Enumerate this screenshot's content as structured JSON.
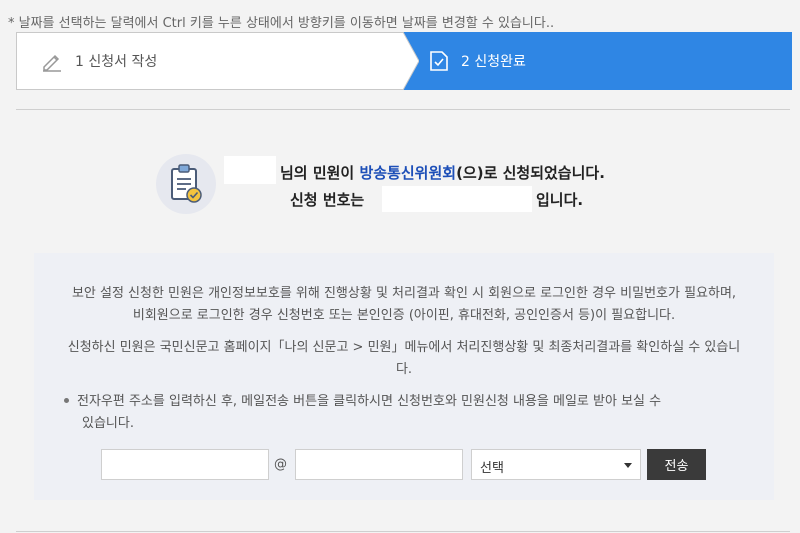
{
  "hint": "* 날짜를 선택하는 달력에서 Ctrl 키를 누른 상태에서 방향키를 이동하면 날짜를 변경할 수 있습니다..",
  "steps": [
    {
      "label": "1 신청서 작성",
      "active": false,
      "icon": "pencil-icon"
    },
    {
      "label": "2 신청완료",
      "active": true,
      "icon": "document-check-icon"
    }
  ],
  "result": {
    "line1_prefix": "님의 민원이 ",
    "organization": "방송통신위원회",
    "line1_suffix": "(으)로 신청되었습니다.",
    "line2_prefix": "신청 번호는",
    "line2_suffix": "입니다."
  },
  "info": {
    "para1": "보안 설정 신청한 민원은 개인정보보호를 위해 진행상황 및 처리결과 확인 시 회원으로 로그인한 경우 비밀번호가 필요하며, 비회원으로 로그인한 경우 신청번호 또는 본인인증 (아이핀, 휴대전화, 공인인증서 등)이 필요합니다.",
    "para2": "신청하신 민원은 국민신문고 홈페이지「나의 신문고 > 민원」메뉴에서 처리진행상황 및 최종처리결과를 확인하실 수 있습니다.",
    "bullet_line1": "전자우편 주소를 입력하신 후, 메일전송 버튼을 클릭하시면 신청번호와 민원신청 내용을 메일로 받아 보실 수",
    "bullet_line2": "있습니다."
  },
  "email_form": {
    "local_value": "",
    "at": "@",
    "domain_value": "",
    "select_value": "선택",
    "send_label": "전송"
  },
  "colors": {
    "accent": "#2f86e4",
    "organization": "#1d4fb8",
    "send_button": "#3a3a3a"
  }
}
